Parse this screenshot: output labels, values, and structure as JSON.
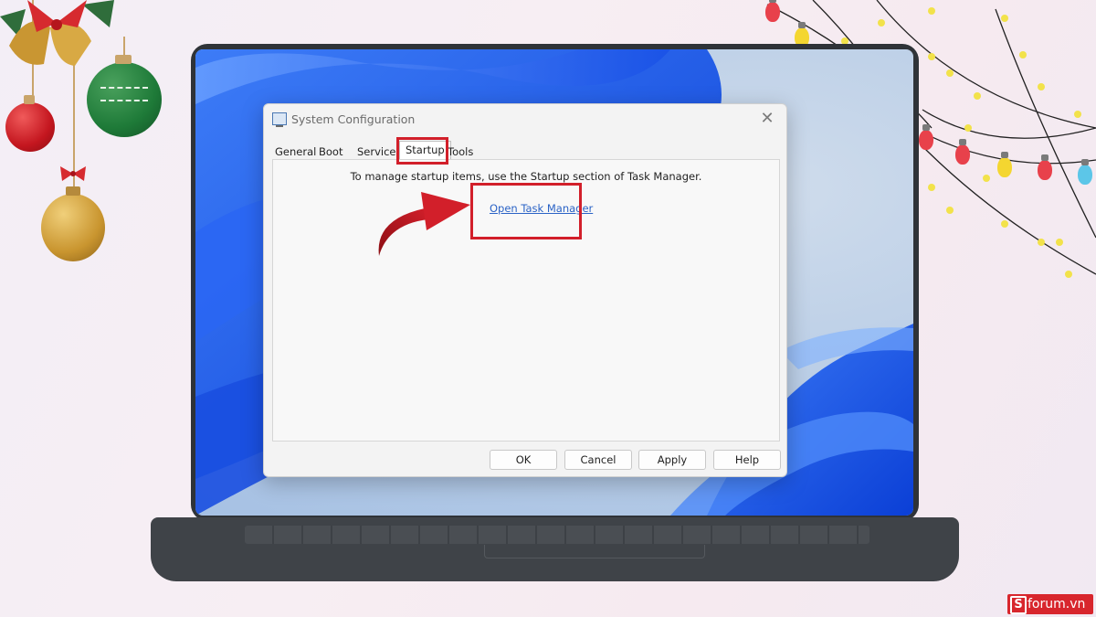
{
  "dialog": {
    "title": "System Configuration",
    "close_glyph": "✕",
    "tabs": [
      "General",
      "Boot",
      "Services",
      "Startup",
      "Tools"
    ],
    "active_tab": "Startup",
    "message": "To manage startup items, use the Startup section of Task Manager.",
    "link_label": "Open Task Manager",
    "buttons": {
      "ok": "OK",
      "cancel": "Cancel",
      "apply": "Apply",
      "help": "Help"
    }
  },
  "watermark": {
    "logo_letter": "S",
    "text": "forum.vn"
  },
  "colors": {
    "highlight": "#d21f2a",
    "link": "#2b63c6",
    "wallpaper_blue": "#1e5bf0",
    "laptop": "#2f3338"
  },
  "icons": [
    "app-monitor-icon",
    "close-icon",
    "red-arrow-icon",
    "christmas-ornaments",
    "string-lights"
  ]
}
